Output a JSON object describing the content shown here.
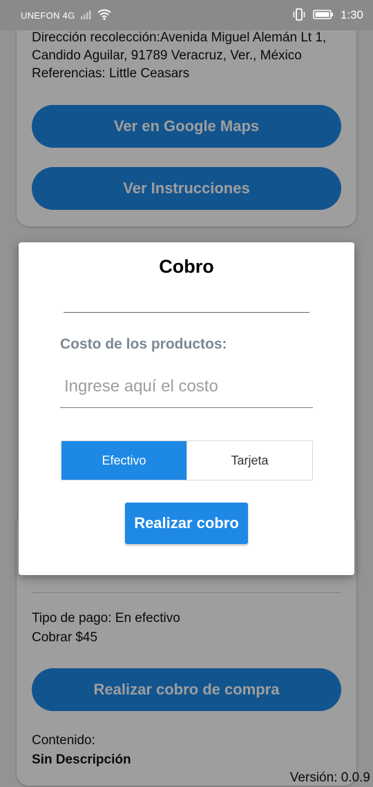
{
  "status_bar": {
    "carrier": "UNEFON 4G",
    "time": "1:30"
  },
  "pickup_card": {
    "address": "Dirección recolección:Avenida Miguel Alemán Lt 1, Candido Aguilar, 91789 Veracruz, Ver., México",
    "references": "Referencias: Little Ceasars",
    "maps_button": "Ver en Google Maps",
    "instructions_button": "Ver Instrucciones"
  },
  "payment_card": {
    "payment_type": "Tipo de pago: En efectivo",
    "charge": "Cobrar $45",
    "charge_button": "Realizar cobro de compra",
    "content_label": "Contenido:",
    "content_value": "Sin Descripción"
  },
  "version": "Versión: 0.0.9",
  "modal": {
    "title": "Cobro",
    "cost_label": "Costo de los productos:",
    "cost_placeholder": "Ingrese aquí el costo",
    "cost_value": "",
    "payment_options": [
      "Efectivo",
      "Tarjeta"
    ],
    "selected_option": "Efectivo",
    "submit_button": "Realizar cobro"
  },
  "colors": {
    "primary": "#1e88e5",
    "label_gray": "#7b8793"
  }
}
